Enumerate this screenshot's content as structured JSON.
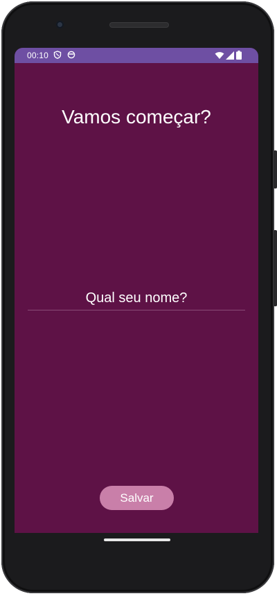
{
  "status_bar": {
    "time": "00:10",
    "icons": [
      "shield-icon",
      "face-icon",
      "wifi-icon",
      "signal-icon",
      "battery-icon"
    ],
    "background_color": "#6e4fa3"
  },
  "screen": {
    "background_color": "#5e1246",
    "title": "Vamos começar?"
  },
  "name_field": {
    "value": "",
    "placeholder": "Qual seu nome?"
  },
  "save_button": {
    "label": "Salvar",
    "color": "#c97fa9"
  }
}
